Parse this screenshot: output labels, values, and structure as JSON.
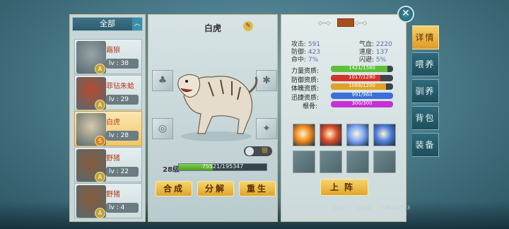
{
  "filter": {
    "label": "全部",
    "arrow": "︿"
  },
  "pets": [
    {
      "name": "霜狼",
      "level": "lv : 38",
      "badge": "A",
      "selected": false,
      "avatar_color": "#9aa3a8"
    },
    {
      "name": "菲钻朱蛤",
      "level": "lv : 29",
      "badge": "A",
      "selected": false,
      "avatar_color": "#b84a30"
    },
    {
      "name": "白虎",
      "level": "lv : 28",
      "badge": "S",
      "selected": true,
      "avatar_color": "#d9c9a9"
    },
    {
      "name": "野猪",
      "level": "lv : 22",
      "badge": "A",
      "selected": false,
      "avatar_color": "#8a5a3a"
    },
    {
      "name": "野猪",
      "level": "lv : 4",
      "badge": "A",
      "selected": false,
      "avatar_color": "#8a5a3a"
    }
  ],
  "pet_detail": {
    "name": "白虎",
    "edit_icon": "✎",
    "lock_label": "锁",
    "level_label": "28级",
    "exp_text": "75521/195347",
    "exp_progress": 0.387
  },
  "buttons": {
    "combine": "合成",
    "split": "分解",
    "rebirth": "重生",
    "deploy": "上阵"
  },
  "stats": {
    "attack_k": "攻击:",
    "attack_v": "591",
    "hp_k": "气血:",
    "hp_v": "2220",
    "defense_k": "防御:",
    "defense_v": "423",
    "speed_k": "速度:",
    "speed_v": "137",
    "hit_k": "命中:",
    "hit_v": "7%",
    "dodge_k": "闪避:",
    "dodge_v": "5%"
  },
  "aptitudes": [
    {
      "label": "力量资质:",
      "text": "1421/1560",
      "progress": 0.91,
      "color": "#5fbf3a"
    },
    {
      "label": "防御资质:",
      "text": "1017/1280",
      "progress": 0.79,
      "color": "#d4332a"
    },
    {
      "label": "体魄资质:",
      "text": "1068/1200",
      "progress": 0.89,
      "color": "#e0a32a"
    },
    {
      "label": "迅捷资质:",
      "text": "991/960",
      "progress": 1.0,
      "color": "#3a6fd8"
    },
    {
      "label": "根骨:",
      "text": "300/300",
      "progress": 1.0,
      "color": "#c531d6"
    }
  ],
  "skills": [
    {
      "icon": "fire-claw-skill-icon",
      "color": "#f08a1e"
    },
    {
      "icon": "flame-slash-skill-icon",
      "color": "#d9482a"
    },
    {
      "icon": "blue-orb-skill-icon",
      "color": "#7fa8ff"
    },
    {
      "icon": "ice-slash-skill-icon",
      "color": "#4f7fe0"
    }
  ],
  "tabs": [
    "详情",
    "喂养",
    "驯养",
    "背包",
    "装备"
  ],
  "close_symbol": "✕",
  "footer": {
    "server": "34区",
    "player": "涂天河",
    "id": "198178793"
  }
}
